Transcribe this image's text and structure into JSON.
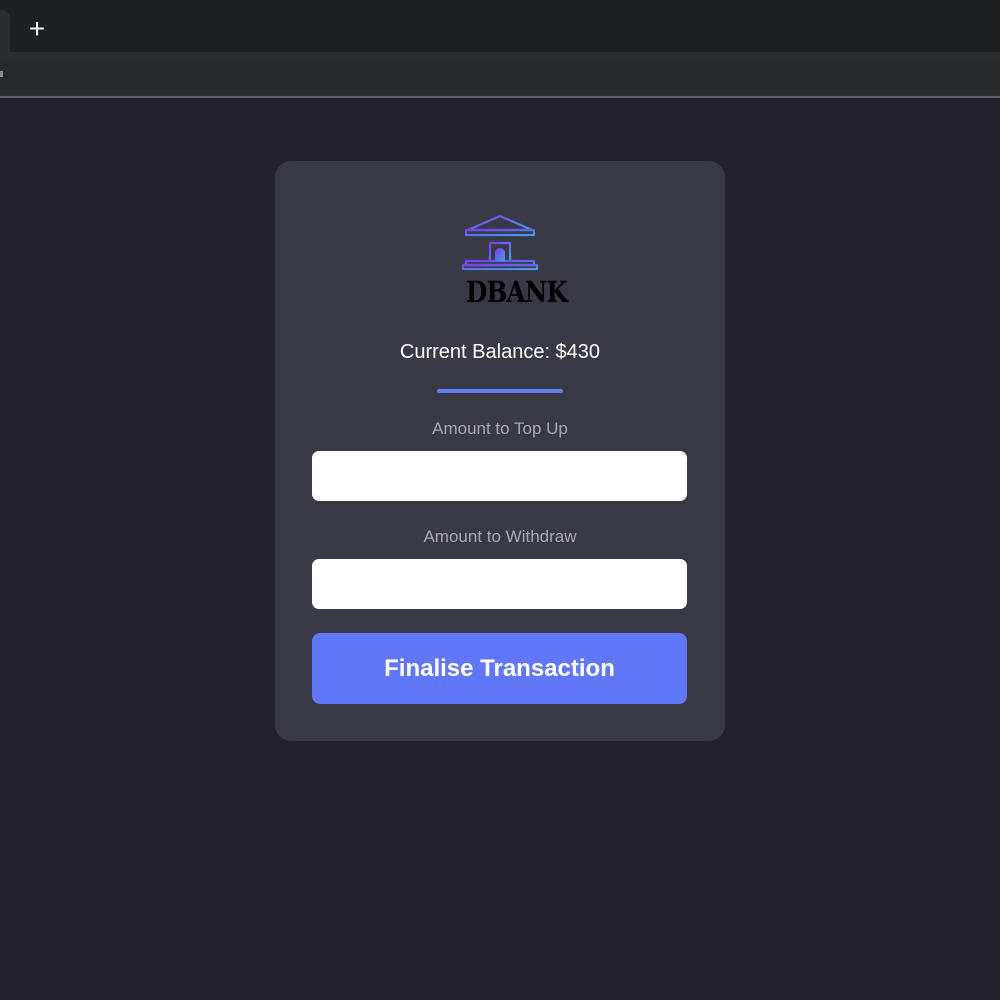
{
  "browser": {
    "new_tab_glyph": "+"
  },
  "app": {
    "logo_text": "DBANK",
    "logo_icon": "bank-building-icon",
    "balance_text": "Current Balance: $430",
    "topup_label": "Amount to Top Up",
    "topup_value": "",
    "withdraw_label": "Amount to Withdraw",
    "withdraw_value": "",
    "submit_label": "Finalise Transaction"
  },
  "colors": {
    "page_background": "#22212d",
    "card_background": "#393845",
    "accent": "#6078f7",
    "divider": "#5f7bf2",
    "logo_gradient_start": "#7a3cf0",
    "logo_gradient_end": "#3fa0e6"
  }
}
